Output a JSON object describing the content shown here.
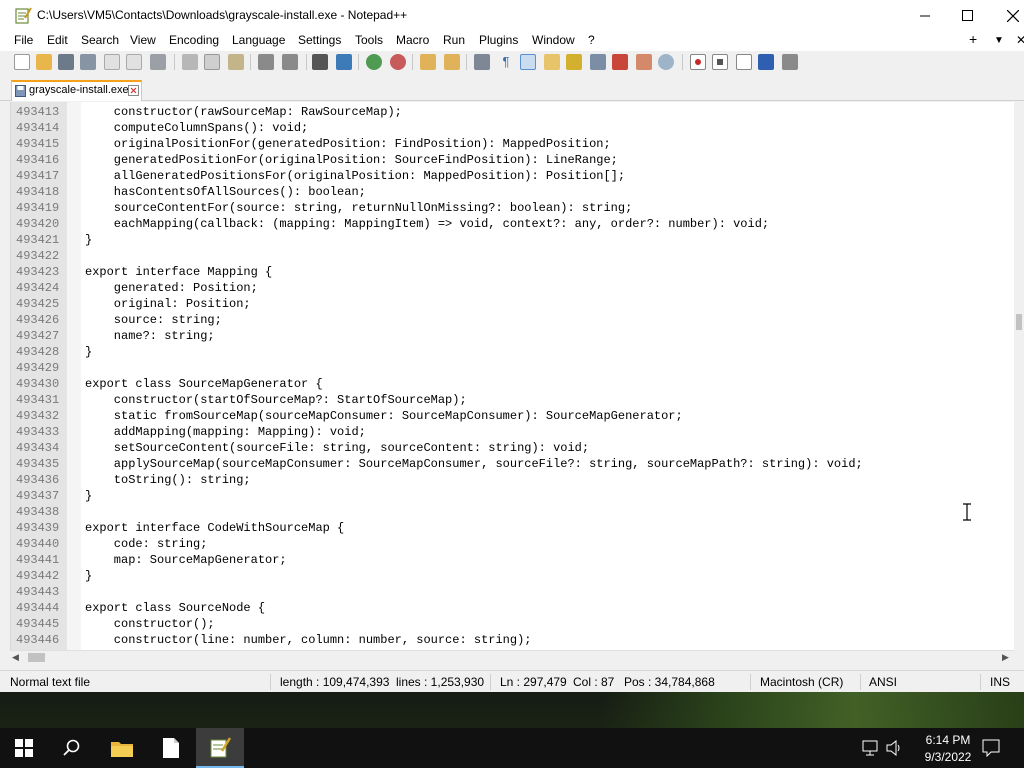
{
  "window": {
    "title": "C:\\Users\\VM5\\Contacts\\Downloads\\grayscale-install.exe - Notepad++",
    "app_icon": "notepadpp-icon",
    "controls": {
      "minimize": "minimize-icon",
      "maximize": "maximize-icon",
      "close": "close-icon"
    }
  },
  "menu": {
    "items": [
      "File",
      "Edit",
      "Search",
      "View",
      "Encoding",
      "Language",
      "Settings",
      "Tools",
      "Macro",
      "Run",
      "Plugins",
      "Window",
      "?"
    ],
    "right": {
      "add": "+",
      "list": "▼",
      "close": "✕"
    }
  },
  "toolbar": {
    "icons": [
      "new-file-icon",
      "open-file-icon",
      "save-icon",
      "save-all-icon",
      "close-icon",
      "close-all-icon",
      "print-icon",
      "cut-icon",
      "copy-icon",
      "paste-icon",
      "undo-icon",
      "redo-icon",
      "find-icon",
      "replace-icon",
      "zoom-in-icon",
      "zoom-out-icon",
      "sync-vertical-icon",
      "sync-horizontal-icon",
      "word-wrap-icon",
      "show-all-chars-icon",
      "indent-guide-icon",
      "udl-icon",
      "doc-map-icon",
      "function-list-icon",
      "folder-workspace-icon",
      "monitoring-icon",
      "record-macro-icon",
      "stop-macro-icon",
      "play-macro-icon",
      "run-macro-multiple-icon",
      "save-macro-icon"
    ]
  },
  "tabs": [
    {
      "label": "grayscale-install.exe",
      "icon": "save-icon",
      "close": "tab-close-icon"
    }
  ],
  "editor": {
    "lines": [
      {
        "n": "493413",
        "t": "    constructor(rawSourceMap: RawSourceMap);"
      },
      {
        "n": "493414",
        "t": "    computeColumnSpans(): void;"
      },
      {
        "n": "493415",
        "t": "    originalPositionFor(generatedPosition: FindPosition): MappedPosition;"
      },
      {
        "n": "493416",
        "t": "    generatedPositionFor(originalPosition: SourceFindPosition): LineRange;"
      },
      {
        "n": "493417",
        "t": "    allGeneratedPositionsFor(originalPosition: MappedPosition): Position[];"
      },
      {
        "n": "493418",
        "t": "    hasContentsOfAllSources(): boolean;"
      },
      {
        "n": "493419",
        "t": "    sourceContentFor(source: string, returnNullOnMissing?: boolean): string;"
      },
      {
        "n": "493420",
        "t": "    eachMapping(callback: (mapping: MappingItem) => void, context?: any, order?: number): void;"
      },
      {
        "n": "493421",
        "t": "}"
      },
      {
        "n": "493422",
        "t": ""
      },
      {
        "n": "493423",
        "t": "export interface Mapping {"
      },
      {
        "n": "493424",
        "t": "    generated: Position;"
      },
      {
        "n": "493425",
        "t": "    original: Position;"
      },
      {
        "n": "493426",
        "t": "    source: string;"
      },
      {
        "n": "493427",
        "t": "    name?: string;"
      },
      {
        "n": "493428",
        "t": "}"
      },
      {
        "n": "493429",
        "t": ""
      },
      {
        "n": "493430",
        "t": "export class SourceMapGenerator {"
      },
      {
        "n": "493431",
        "t": "    constructor(startOfSourceMap?: StartOfSourceMap);"
      },
      {
        "n": "493432",
        "t": "    static fromSourceMap(sourceMapConsumer: SourceMapConsumer): SourceMapGenerator;"
      },
      {
        "n": "493433",
        "t": "    addMapping(mapping: Mapping): void;"
      },
      {
        "n": "493434",
        "t": "    setSourceContent(sourceFile: string, sourceContent: string): void;"
      },
      {
        "n": "493435",
        "t": "    applySourceMap(sourceMapConsumer: SourceMapConsumer, sourceFile?: string, sourceMapPath?: string): void;"
      },
      {
        "n": "493436",
        "t": "    toString(): string;"
      },
      {
        "n": "493437",
        "t": "}"
      },
      {
        "n": "493438",
        "t": ""
      },
      {
        "n": "493439",
        "t": "export interface CodeWithSourceMap {"
      },
      {
        "n": "493440",
        "t": "    code: string;"
      },
      {
        "n": "493441",
        "t": "    map: SourceMapGenerator;"
      },
      {
        "n": "493442",
        "t": "}"
      },
      {
        "n": "493443",
        "t": ""
      },
      {
        "n": "493444",
        "t": "export class SourceNode {"
      },
      {
        "n": "493445",
        "t": "    constructor();"
      },
      {
        "n": "493446",
        "t": "    constructor(line: number, column: number, source: string);"
      }
    ]
  },
  "statusbar": {
    "type": "Normal text file",
    "length": "length : 109,474,393",
    "lines": "lines : 1,253,930",
    "ln": "Ln : 297,479",
    "col": "Col : 87",
    "pos": "Pos : 34,784,868",
    "eol": "Macintosh (CR)",
    "encoding": "ANSI",
    "mode": "INS"
  },
  "taskbar": {
    "items": [
      "start-icon",
      "search-icon",
      "file-explorer-icon",
      "notepad-icon",
      "notepadpp-icon"
    ],
    "tray": {
      "network": "network-icon",
      "volume": "volume-icon",
      "notifications": "notification-icon"
    },
    "time": "6:14 PM",
    "date": "9/3/2022"
  },
  "colors": {
    "tab_accent": "#f6a11c",
    "line_number": "#7a7a7a",
    "taskbar": "#111111"
  }
}
